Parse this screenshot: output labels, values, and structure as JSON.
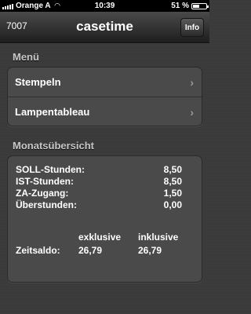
{
  "status_bar": {
    "carrier": "Orange A",
    "time": "10:39",
    "battery": "51 %",
    "battery_level": 0.51
  },
  "nav": {
    "left_text": "7007",
    "title": "casetime",
    "info_label": "Info"
  },
  "menu": {
    "header": "Menü",
    "items": [
      {
        "label": "Stempeln"
      },
      {
        "label": "Lampentableau"
      }
    ]
  },
  "overview": {
    "header": "Monatsübersicht",
    "rows": [
      {
        "label": "SOLL-Stunden:",
        "value": "8,50"
      },
      {
        "label": "IST-Stunden:",
        "value": "8,50"
      },
      {
        "label": "ZA-Zugang:",
        "value": "1,50"
      },
      {
        "label": "Überstunden:",
        "value": "0,00"
      }
    ],
    "col_exclusive": "exklusive",
    "col_inclusive": "inklusive",
    "saldo_label": "Zeitsaldo:",
    "saldo_exclusive": "26,79",
    "saldo_inclusive": "26,79"
  }
}
